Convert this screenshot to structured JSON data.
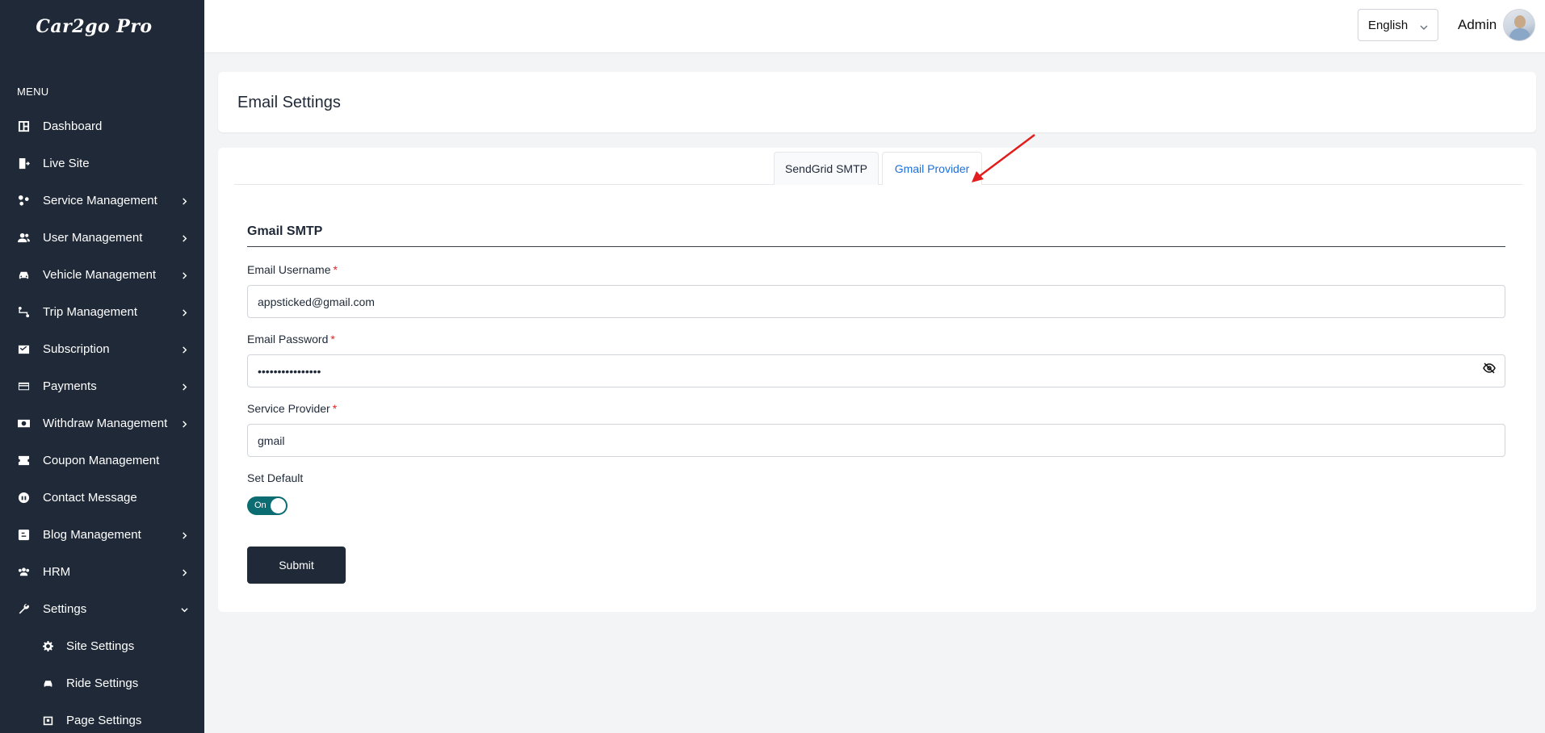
{
  "app": {
    "logo": "Car2go Pro"
  },
  "sidebar": {
    "menu_heading": "MENU",
    "items": [
      {
        "label": "Dashboard",
        "icon": "dashboard-icon",
        "has_chevron": false
      },
      {
        "label": "Live Site",
        "icon": "external-link-icon",
        "has_chevron": false
      },
      {
        "label": "Service Management",
        "icon": "services-icon",
        "has_chevron": true
      },
      {
        "label": "User Management",
        "icon": "users-icon",
        "has_chevron": true
      },
      {
        "label": "Vehicle Management",
        "icon": "car-icon",
        "has_chevron": true
      },
      {
        "label": "Trip Management",
        "icon": "route-icon",
        "has_chevron": true
      },
      {
        "label": "Subscription",
        "icon": "subscription-icon",
        "has_chevron": true
      },
      {
        "label": "Payments",
        "icon": "credit-card-icon",
        "has_chevron": true
      },
      {
        "label": "Withdraw Management",
        "icon": "money-icon",
        "has_chevron": true
      },
      {
        "label": "Coupon Management",
        "icon": "coupon-icon",
        "has_chevron": false
      },
      {
        "label": "Contact Message",
        "icon": "headset-icon",
        "has_chevron": false
      },
      {
        "label": "Blog Management",
        "icon": "blog-icon",
        "has_chevron": true
      },
      {
        "label": "HRM",
        "icon": "team-icon",
        "has_chevron": true
      },
      {
        "label": "Settings",
        "icon": "wrench-icon",
        "has_chevron": true,
        "expanded": true
      }
    ],
    "sub_items": [
      {
        "label": "Site Settings",
        "icon": "gear-icon"
      },
      {
        "label": "Ride Settings",
        "icon": "car-icon"
      },
      {
        "label": "Page Settings",
        "icon": "page-icon"
      }
    ]
  },
  "topbar": {
    "language": "English",
    "user_name": "Admin"
  },
  "page": {
    "title": "Email Settings"
  },
  "tabs": [
    {
      "label": "SendGrid SMTP",
      "active": false
    },
    {
      "label": "Gmail Provider",
      "active": true
    }
  ],
  "form": {
    "section_title": "Gmail SMTP",
    "username_label": "Email Username",
    "username_value": "appsticked@gmail.com",
    "password_label": "Email Password",
    "password_value": "••••••••••••••••",
    "provider_label": "Service Provider",
    "provider_value": "gmail",
    "default_label": "Set Default",
    "default_state": "On",
    "required_mark": "*",
    "submit_label": "Submit"
  },
  "colors": {
    "sidebar_bg": "#1f2937",
    "active_tab": "#1d6fdc",
    "toggle_on": "#0b6c72",
    "required": "#dc2626",
    "annotation_arrow": "#e11d1d"
  }
}
